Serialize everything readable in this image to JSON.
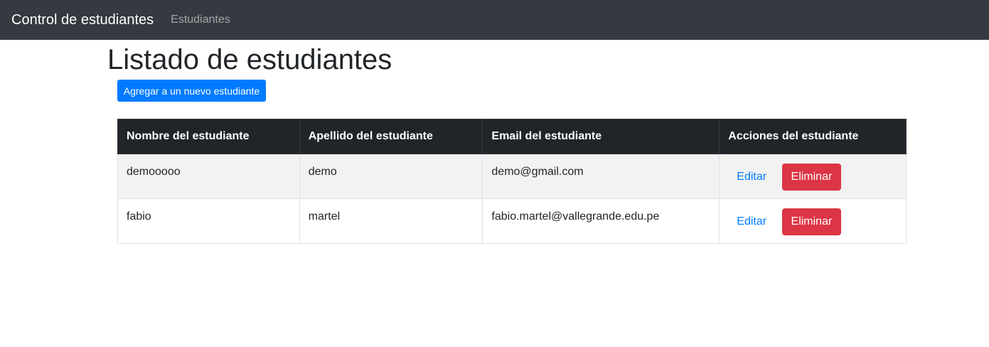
{
  "navbar": {
    "brand": "Control de estudiantes",
    "links": [
      {
        "label": "Estudiantes"
      }
    ]
  },
  "main": {
    "title": "Listado de estudiantes",
    "add_button_label": "Agregar a un nuevo estudiante",
    "table": {
      "headers": [
        "Nombre del estudiante",
        "Apellido del estudiante",
        "Email del estudiante",
        "Acciones del estudiante"
      ],
      "rows": [
        {
          "nombre": "demooooo",
          "apellido": "demo",
          "email": "demo@gmail.com",
          "edit_label": "Editar",
          "delete_label": "Eliminar"
        },
        {
          "nombre": "fabio",
          "apellido": "martel",
          "email": "fabio.martel@vallegrande.edu.pe",
          "edit_label": "Editar",
          "delete_label": "Eliminar"
        }
      ]
    }
  },
  "colors": {
    "navbar_bg": "#343a40",
    "primary": "#007bff",
    "danger": "#dc3545",
    "table_header_bg": "#212529",
    "striped_row_bg": "#f2f2f2"
  }
}
